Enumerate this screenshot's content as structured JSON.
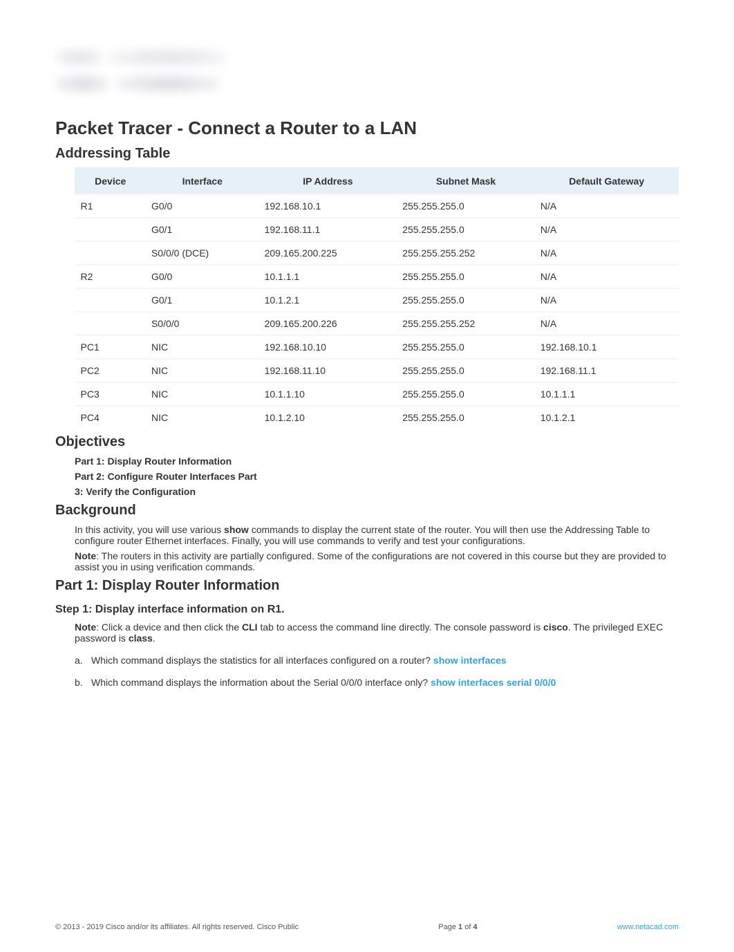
{
  "page_title": "Packet Tracer - Connect a Router to a LAN",
  "sections": {
    "addressing_table": "Addressing Table",
    "objectives": "Objectives",
    "background": "Background",
    "part1": "Part 1: Display Router Information"
  },
  "table": {
    "headers": {
      "device": "Device",
      "interface": "Interface",
      "ip": "IP Address",
      "mask": "Subnet Mask",
      "gw": "Default Gateway"
    },
    "rows": [
      {
        "device": "R1",
        "interface": "G0/0",
        "ip": "192.168.10.1",
        "mask": "255.255.255.0",
        "gw": "N/A"
      },
      {
        "device": "",
        "interface": "G0/1",
        "ip": "192.168.11.1",
        "mask": "255.255.255.0",
        "gw": "N/A"
      },
      {
        "device": "",
        "interface": "S0/0/0 (DCE)",
        "ip": "209.165.200.225",
        "mask": "255.255.255.252",
        "gw": "N/A"
      },
      {
        "device": "R2",
        "interface": "G0/0",
        "ip": "10.1.1.1",
        "mask": "255.255.255.0",
        "gw": "N/A"
      },
      {
        "device": "",
        "interface": "G0/1",
        "ip": "10.1.2.1",
        "mask": "255.255.255.0",
        "gw": "N/A"
      },
      {
        "device": "",
        "interface": "S0/0/0",
        "ip": "209.165.200.226",
        "mask": "255.255.255.252",
        "gw": "N/A"
      },
      {
        "device": "PC1",
        "interface": "NIC",
        "ip": "192.168.10.10",
        "mask": "255.255.255.0",
        "gw": "192.168.10.1"
      },
      {
        "device": "PC2",
        "interface": "NIC",
        "ip": "192.168.11.10",
        "mask": "255.255.255.0",
        "gw": "192.168.11.1"
      },
      {
        "device": "PC3",
        "interface": "NIC",
        "ip": "10.1.1.10",
        "mask": "255.255.255.0",
        "gw": "10.1.1.1"
      },
      {
        "device": "PC4",
        "interface": "NIC",
        "ip": "10.1.2.10",
        "mask": "255.255.255.0",
        "gw": "10.1.2.1"
      }
    ]
  },
  "objectives": {
    "line1": "Part 1: Display Router Information",
    "line2": "Part 2: Configure Router Interfaces Part",
    "line3": "3: Verify the Configuration"
  },
  "background": {
    "p1_a": "In this activity, you will use various ",
    "p1_show": "show",
    "p1_b": " commands to display the current state of the router. You will then use the Addressing Table to configure router Ethernet interfaces. Finally, you will use commands to verify and test your configurations.",
    "p2_note": "Note",
    "p2_rest": ": The routers in this activity are partially configured. Some of the configurations are not covered in this course but they are provided to assist you in using verification commands."
  },
  "step1": {
    "heading": "Step 1: Display interface information on R1.",
    "p_note": "Note",
    "p_a": ": Click a device and then click the ",
    "p_cli": "CLI",
    "p_b": " tab to access the command line directly. The console password is ",
    "p_cisco": "cisco",
    "p_c": ". The privileged EXEC password is ",
    "p_class": "class",
    "p_d": ".",
    "a_q": "Which command displays the statistics for all interfaces configured on a router? ",
    "a_ans": "show interfaces",
    "b_q": "Which command displays the information about the Serial 0/0/0 interface only?  ",
    "b_ans": "show interfaces serial 0/0/0"
  },
  "footer": {
    "left": "© 2013 - 2019 Cisco and/or its affiliates. All rights reserved. Cisco Public",
    "center_a": "Page ",
    "center_b": "1",
    "center_c": " of ",
    "center_d": "4",
    "right": "www.netacad.com"
  }
}
